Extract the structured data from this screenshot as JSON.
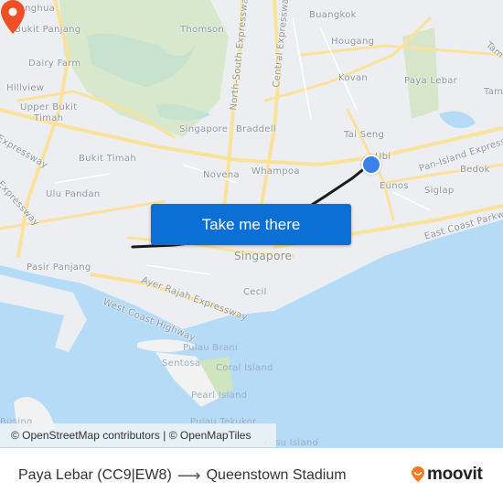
{
  "map": {
    "labels": {
      "chenghua": "henghua",
      "bukit_panjang": "Bukit Panjang",
      "dairy_farm": "Dairy Farm",
      "hillview": "Hillview",
      "upper_bukit_timah_1": "Upper Bukit",
      "upper_bukit_timah_2": "Timah",
      "thomson": "Thomson",
      "buangkok": "Buangkok",
      "hougang": "Hougang",
      "kovan": "Kovan",
      "paya_lebar": "Paya Lebar",
      "tampines": "Tam",
      "tampines_exp": "Tam",
      "singapore_north": "Singapore",
      "braddell": "Braddell",
      "tai_seng": "Tai Seng",
      "ubi": "Ubi",
      "bukit_timah": "Bukit Timah",
      "novena": "Novena",
      "whampoa": "Whampoa",
      "eunos": "Eunos",
      "siglap": "Siglap",
      "bedok": "Bedok",
      "ulu_pandan": "Ulu Pandan",
      "pasir_panjang": "Pasir Panjang",
      "singapore_city": "Singapore",
      "cecil": "Cecil",
      "pulau_brani": "Pulau Brani",
      "sentosa": "Sentosa",
      "coral_island": "Coral Island",
      "pearl_island": "Pearl Island",
      "pulau_tekukor": "Pulau Tekukor",
      "kusu_island": "Kusu Island",
      "busing": "Busing",
      "north_south_exp": "North-South Expressway",
      "central_exp": "Central Expressway",
      "pan_island_exp": "Pan-Island Expressway",
      "east_coast_pkwy": "East Coast Parkway",
      "ayer_rajah_exp": "Ayer Rajah Expressway",
      "west_coast_hwy": "West Coast Highway",
      "bke_exp": "Expressway",
      "aye_west_exp": "Expressway"
    },
    "cta_label": "Take me there",
    "attribution": "© OpenStreetMap contributors | © OpenMapTiles",
    "colors": {
      "water": "#b5dbf7",
      "park": "#cfe5be",
      "road": "#fbe29a",
      "route_line": "#1a1a1a",
      "origin": "#3b82e8",
      "destination": "#f04e23",
      "cta": "#0a70d6"
    }
  },
  "footer": {
    "origin": "Paya Lebar (CC9|EW8)",
    "arrow": "⟶",
    "destination": "Queenstown Stadium",
    "brand": "moovit"
  }
}
